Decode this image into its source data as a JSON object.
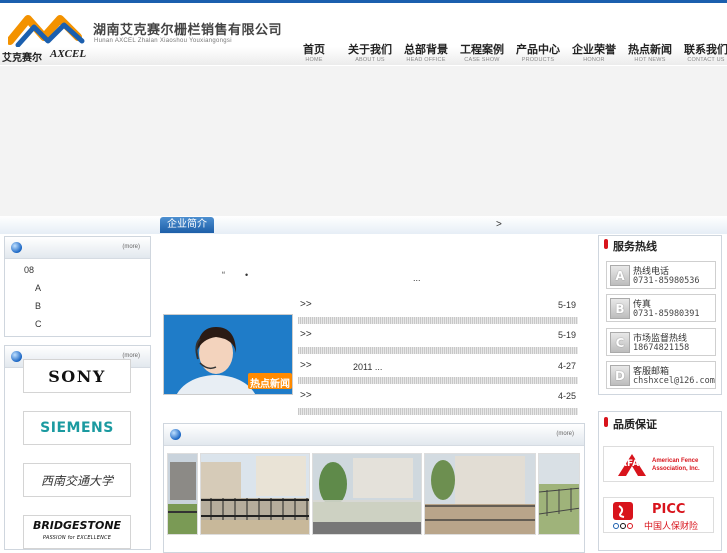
{
  "brand": {
    "logo_cn": "艾克赛尔",
    "logo_en": "AXCEL",
    "company_cn": "湖南艾克赛尔栅栏销售有限公司",
    "company_en": "Hunan AXCEL Zhalan Xiaoshou Youxiangongsi",
    "colors": {
      "blue": "#1b5fae",
      "orange": "#f39200"
    }
  },
  "nav": [
    {
      "label": "首页",
      "sub": "HOME",
      "color": "#e02020"
    },
    {
      "label": "关于我们",
      "sub": "ABOUT US",
      "color": "#3c7fd0"
    },
    {
      "label": "总部背景",
      "sub": "HEAD OFFICE",
      "color": "#f39200"
    },
    {
      "label": "工程案例",
      "sub": "CASE SHOW",
      "color": "#7a4fb0"
    },
    {
      "label": "产品中心",
      "sub": "PRODUCTS",
      "color": "#f0c000"
    },
    {
      "label": "企业荣誉",
      "sub": "HONOR",
      "color": "#e02020"
    },
    {
      "label": "热点新闻",
      "sub": "HOT NEWS",
      "color": "#3c7fd0"
    },
    {
      "label": "联系我们",
      "sub": "CONTACT US",
      "color": "#f39200"
    }
  ],
  "about": {
    "tab_label": "企业简介",
    "marker": ">"
  },
  "product_box": {
    "more": "(more)",
    "tree": [
      {
        "label": "08",
        "level": 0
      },
      {
        "label": "A",
        "level": 1
      },
      {
        "label": "B",
        "level": 1
      },
      {
        "label": "C",
        "level": 1
      }
    ]
  },
  "partners_box": {
    "more": "(more)",
    "logos": [
      {
        "name": "SONY"
      },
      {
        "name": "SIEMENS"
      },
      {
        "name": "西南交通大学"
      },
      {
        "name": "BRIDGESTONE",
        "tagline": "PASSION for EXCELLENCE"
      }
    ]
  },
  "intro": {
    "quote": "“",
    "dot": "•",
    "ellipsis": "..."
  },
  "news": {
    "photo_caption": "热点新闻",
    "arrow": ">>",
    "items": [
      {
        "title": "",
        "date": "5-19"
      },
      {
        "title": "",
        "date": "5-19"
      },
      {
        "title": "2011  ...",
        "date": "4-27"
      },
      {
        "title": "",
        "date": "4-25"
      }
    ]
  },
  "cases_box": {
    "more": "(more)"
  },
  "service": {
    "title": "服务热线",
    "contacts": [
      {
        "letter": "A",
        "label": "热线电话",
        "value": "0731-85980536"
      },
      {
        "letter": "B",
        "label": "传真",
        "value": "0731-85980391"
      },
      {
        "letter": "C",
        "label": "市场监督热线",
        "value": "18674821158"
      },
      {
        "letter": "D",
        "label": "客服邮箱",
        "value": "chshxcel@126.com"
      }
    ]
  },
  "quality": {
    "title": "品质保证",
    "afa_mark": "AFA",
    "afa_text": "American Fence Association, Inc.",
    "picc_mark": "PICC",
    "picc_text": "中国人保财险"
  }
}
